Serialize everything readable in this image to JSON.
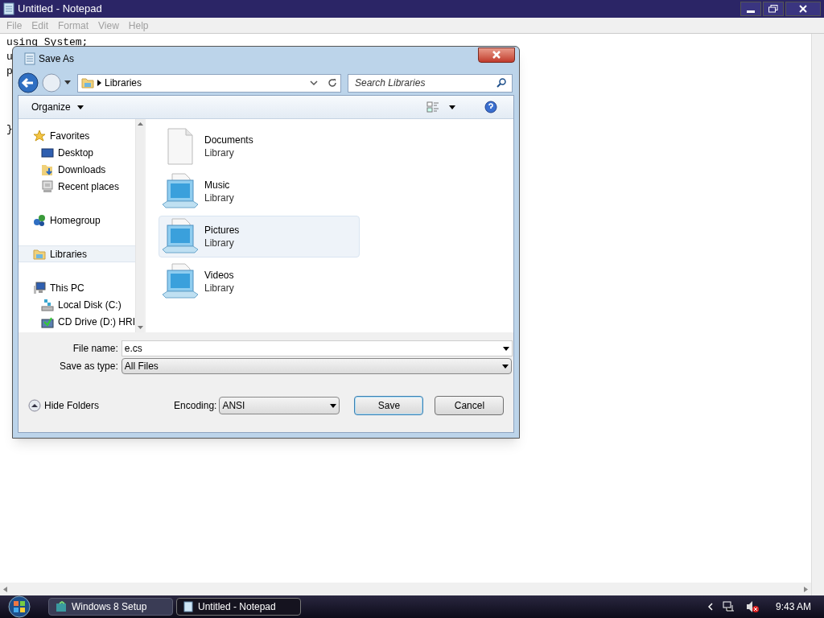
{
  "notepad": {
    "title": "Untitled - Notepad",
    "menu": [
      {
        "label": "File",
        "disabled": true
      },
      {
        "label": "Edit",
        "disabled": true
      },
      {
        "label": "Format",
        "disabled": true
      },
      {
        "label": "View",
        "disabled": true
      },
      {
        "label": "Help",
        "disabled": true
      }
    ],
    "code_lines": [
      "using System;",
      "u",
      "p"
    ],
    "closing_line": "}"
  },
  "dialog": {
    "title": "Save As",
    "address": {
      "crumb": "Libraries"
    },
    "search": {
      "placeholder": "Search Libraries"
    },
    "toolbar": {
      "organize": "Organize"
    },
    "nav": [
      {
        "label": "Favorites",
        "selected": false,
        "children": [
          {
            "label": "Desktop",
            "selected": false
          },
          {
            "label": "Downloads",
            "selected": false
          },
          {
            "label": "Recent places",
            "selected": false
          }
        ]
      },
      {
        "label": "Homegroup",
        "selected": false
      },
      {
        "label": "Libraries",
        "selected": true
      },
      {
        "label": "This PC",
        "selected": false,
        "children": [
          {
            "label": "Local Disk (C:)",
            "selected": false
          },
          {
            "label": "CD Drive (D:) HRI",
            "selected": false
          }
        ]
      }
    ],
    "libraries": [
      {
        "kind": "document",
        "name": "Documents",
        "type": "Library",
        "selected": false
      },
      {
        "kind": "media",
        "name": "Music",
        "type": "Library",
        "selected": false
      },
      {
        "kind": "media",
        "name": "Pictures",
        "type": "Library",
        "selected": true
      },
      {
        "kind": "media",
        "name": "Videos",
        "type": "Library",
        "selected": false
      }
    ],
    "file_name": {
      "label": "File name:",
      "value": "e.cs"
    },
    "save_type": {
      "label": "Save as type:",
      "value": "All Files"
    },
    "hide_folders": "Hide Folders",
    "encoding": {
      "label": "Encoding:",
      "value": "ANSI"
    },
    "buttons": [
      {
        "label": "Save",
        "default": true
      },
      {
        "label": "Cancel",
        "default": false
      }
    ]
  },
  "taskbar": {
    "tasks": [
      {
        "label": "Windows 8 Setup",
        "selected": false
      },
      {
        "label": "Untitled - Notepad",
        "selected": true
      }
    ],
    "clock": "9:43 AM"
  }
}
